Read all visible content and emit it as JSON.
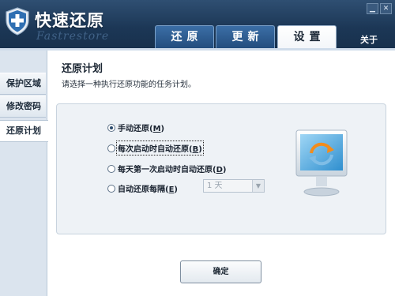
{
  "app": {
    "title": "快速还原",
    "subtitle": "Fastrestore"
  },
  "window_controls": {
    "minimize_label": "▁",
    "close_label": "✕"
  },
  "tabs": [
    {
      "label": "还原",
      "active": false
    },
    {
      "label": "更新",
      "active": false
    },
    {
      "label": "设置",
      "active": true
    }
  ],
  "header": {
    "about_label": "关于"
  },
  "sidebar": {
    "items": [
      {
        "label": "保护区域",
        "active": false
      },
      {
        "label": "修改密码",
        "active": false
      },
      {
        "label": "还原计划",
        "active": true
      }
    ]
  },
  "content": {
    "title": "还原计划",
    "description": "请选择一种执行还原功能的任务计划。",
    "options": [
      {
        "prefix": "手动还原(",
        "key": "M",
        "suffix": ")",
        "checked": true
      },
      {
        "prefix": "每次启动时自动还原(",
        "key": "B",
        "suffix": ")",
        "checked": false
      },
      {
        "prefix": "每天第一次启动时自动还原(",
        "key": "D",
        "suffix": ")",
        "checked": false
      },
      {
        "prefix": "自动还原每隔(",
        "key": "E",
        "suffix": ")",
        "checked": false
      }
    ],
    "interval_select": {
      "value": "1 天",
      "enabled": false
    },
    "ok_label": "确定"
  },
  "colors": {
    "header_bg": "#1c3756",
    "tab_blue": "#2a5a8e",
    "accent_white": "#ffffff",
    "plan_box_bg": "#eef2f6",
    "sidebar_bg": "#dbe4ee"
  },
  "icons": [
    "shield-plus-icon",
    "monitor-restore-icon",
    "radio-icon",
    "dropdown-arrow-icon"
  ]
}
